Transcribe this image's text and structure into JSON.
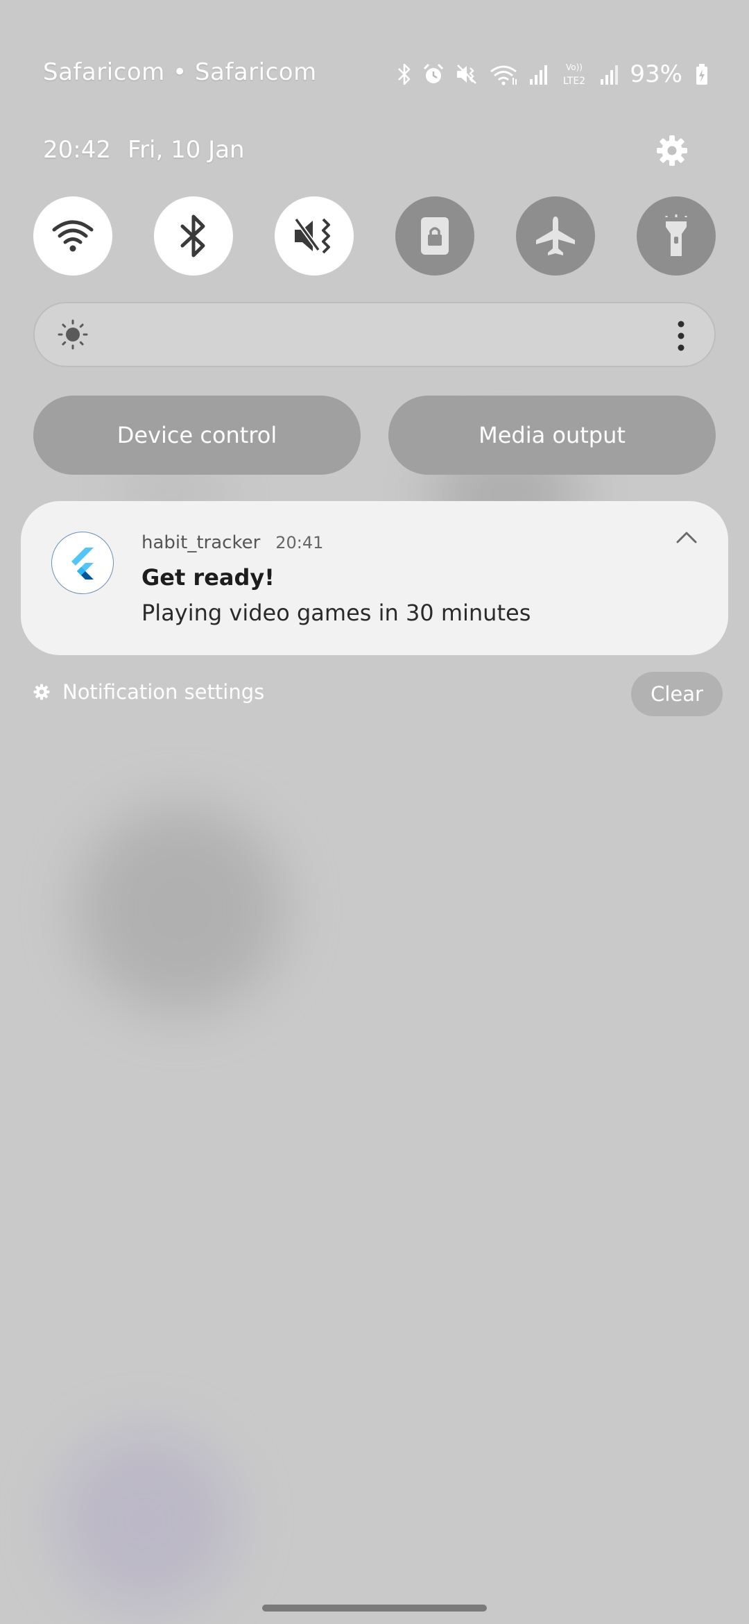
{
  "status_bar": {
    "carrier": "Safaricom • Safaricom",
    "battery": "93%",
    "network_label": "Vo)) LTE2",
    "icons": [
      "bluetooth-icon",
      "alarm-icon",
      "vibrate-mute-icon",
      "wifi-icon",
      "signal-icon",
      "volte-lte-icon",
      "signal-icon",
      "battery-charging-icon"
    ]
  },
  "header": {
    "time": "20:42",
    "date": "Fri, 10 Jan"
  },
  "quick_tiles": [
    {
      "name": "wifi",
      "icon": "wifi-icon",
      "state": "on"
    },
    {
      "name": "bluetooth",
      "icon": "bluetooth-icon",
      "state": "on"
    },
    {
      "name": "sound",
      "icon": "mute-vibrate-icon",
      "state": "on"
    },
    {
      "name": "rotation-lock",
      "icon": "portrait-lock-icon",
      "state": "off"
    },
    {
      "name": "airplane-mode",
      "icon": "airplane-icon",
      "state": "off"
    },
    {
      "name": "flashlight",
      "icon": "flashlight-icon",
      "state": "off"
    }
  ],
  "brightness": {
    "icon": "sun-icon",
    "more_icon": "more-vertical-icon"
  },
  "buttons": {
    "device_control": "Device control",
    "media_output": "Media output"
  },
  "notification": {
    "app_name": "habit_tracker",
    "time": "20:41",
    "title": "Get ready!",
    "body": "Playing video games in 30 minutes",
    "icon": "flutter-logo-icon"
  },
  "footer": {
    "notification_settings": "Notification settings",
    "clear": "Clear"
  },
  "colors": {
    "background": "#c9c9c9",
    "tile_on": "#ffffff",
    "tile_off": "#8e8e8e",
    "notification_bg": "#f2f2f2",
    "flutter_light": "#54c5f8",
    "flutter_dark": "#01579b"
  }
}
